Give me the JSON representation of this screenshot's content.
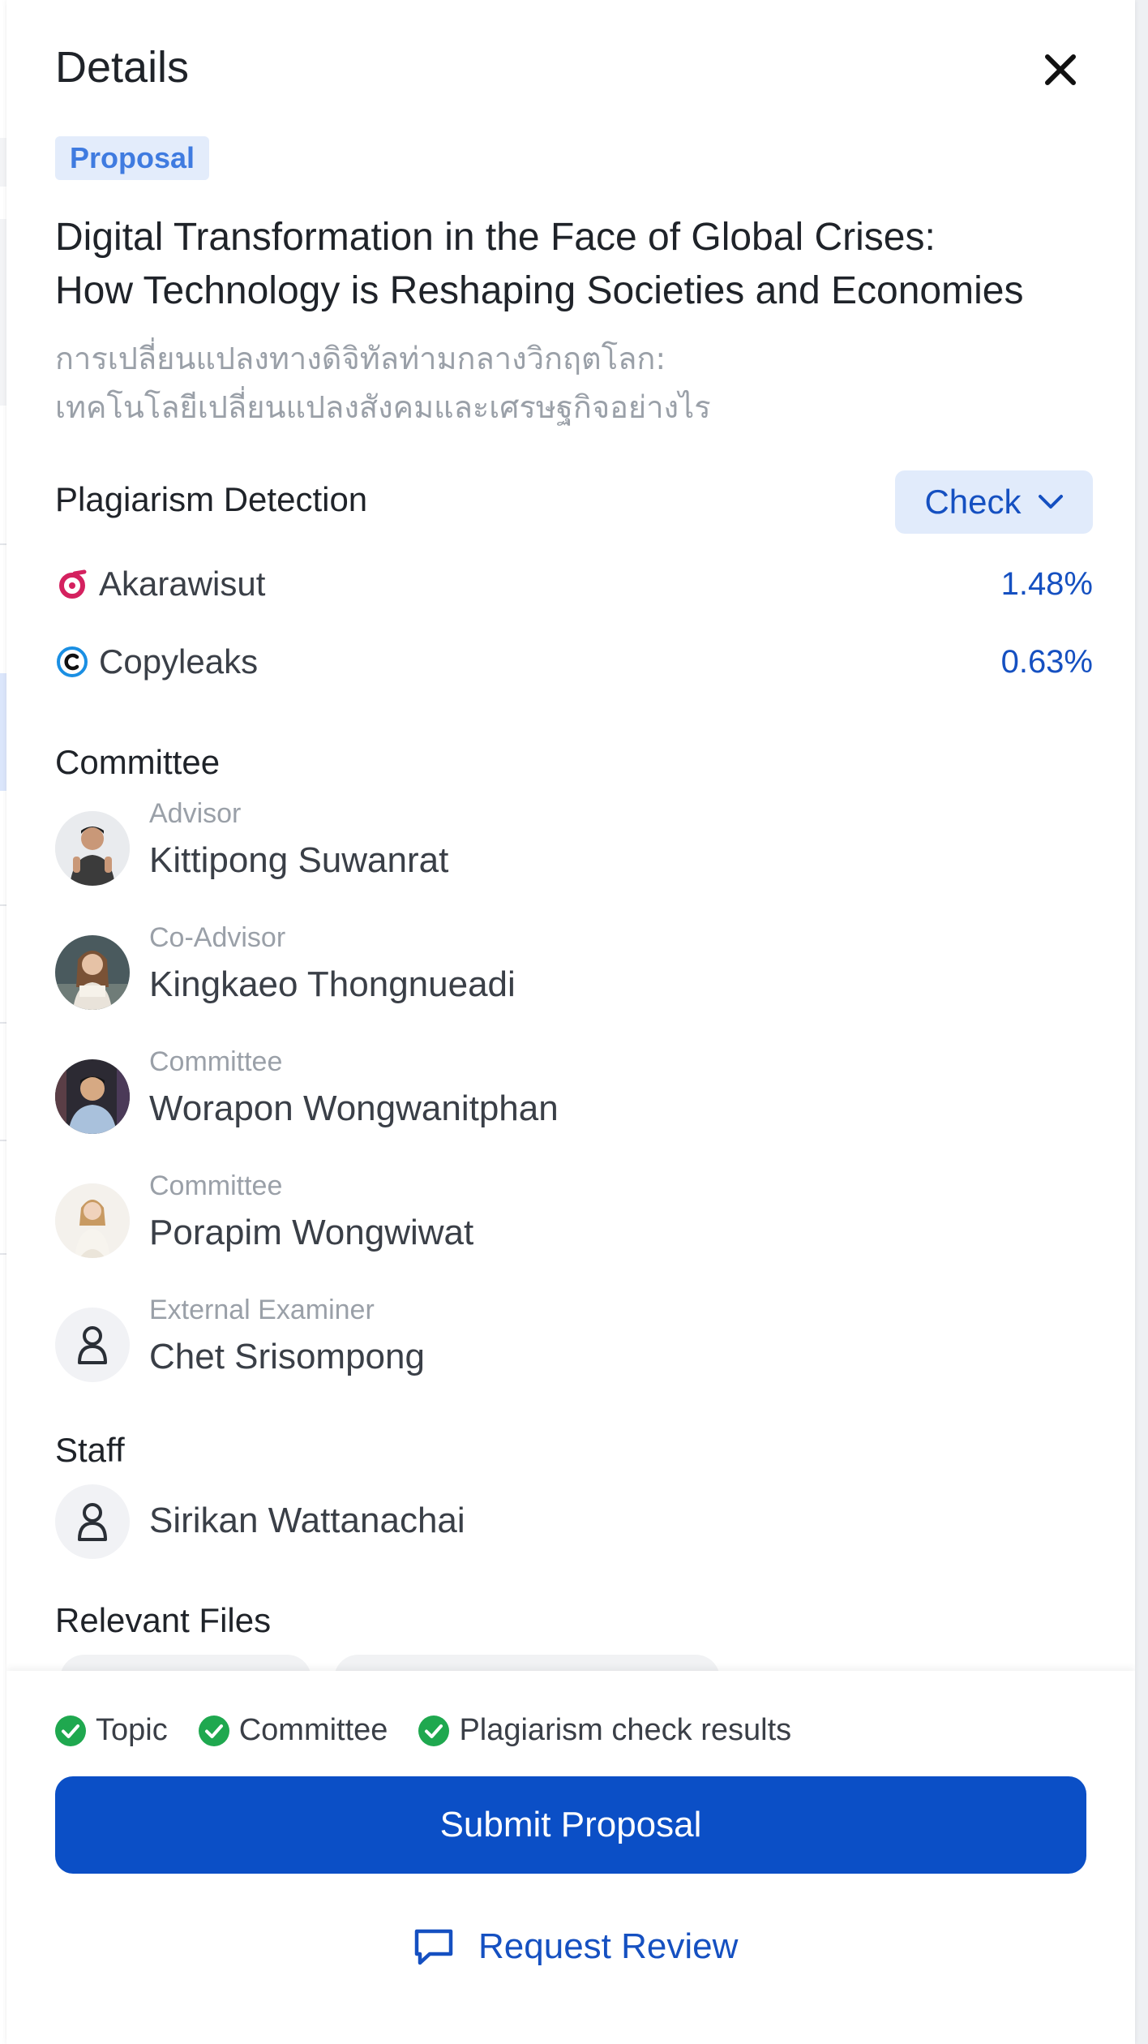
{
  "header": {
    "title": "Details"
  },
  "badge": {
    "label": "Proposal"
  },
  "proposal": {
    "title_en_line1": "Digital Transformation in the Face of Global Crises:",
    "title_en_line2": "How Technology is Reshaping Societies and Economies",
    "title_th_line1": "การเปลี่ยนแปลงทางดิจิทัลท่ามกลางวิกฤตโลก:",
    "title_th_line2": "เทคโนโลยีเปลี่ยนแปลงสังคมและเศรษฐกิจอย่างไร"
  },
  "plagiarism": {
    "heading": "Plagiarism Detection",
    "check_label": "Check",
    "results": [
      {
        "name": "Akarawisut",
        "value": "1.48%",
        "icon": "akarawisut-logo-icon"
      },
      {
        "name": "Copyleaks",
        "value": "0.63%",
        "icon": "copyleaks-logo-icon"
      }
    ]
  },
  "committee": {
    "heading": "Committee",
    "members": [
      {
        "role": "Advisor",
        "name": "Kittipong Suwanrat"
      },
      {
        "role": "Co-Advisor",
        "name": "Kingkaeo Thongnueadi"
      },
      {
        "role": "Committee",
        "name": "Worapon Wongwanitphan"
      },
      {
        "role": "Committee",
        "name": "Porapim Wongwiwat"
      },
      {
        "role": "External Examiner",
        "name": "Chet Srisompong"
      }
    ]
  },
  "staff": {
    "heading": "Staff",
    "members": [
      {
        "name": "Sirikan Wattanachai"
      }
    ]
  },
  "files": {
    "heading": "Relevant Files"
  },
  "footer": {
    "checklist": [
      "Topic",
      "Committee",
      "Plagiarism check results"
    ],
    "submit_label": "Submit Proposal",
    "review_label": "Request Review"
  },
  "colors": {
    "primary": "#0b4fc6",
    "link": "#1550c1",
    "badge_bg": "#e3ecfb",
    "badge_text": "#3f7be0",
    "success": "#1fa84f",
    "muted": "#9aa0a8"
  }
}
